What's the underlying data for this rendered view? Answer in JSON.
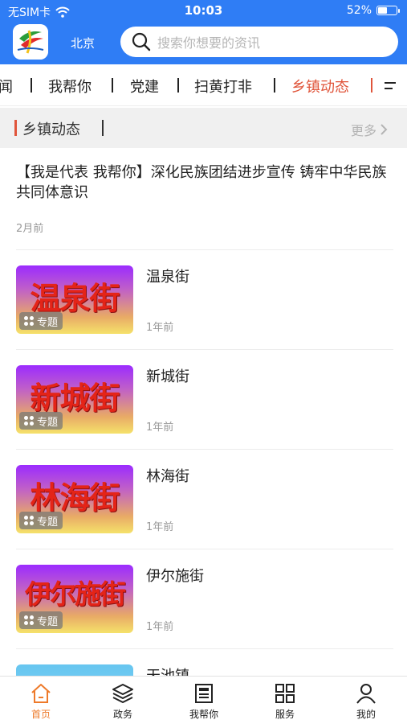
{
  "status_bar": {
    "carrier": "无SIM卡",
    "time": "10:03",
    "battery_text": "52%",
    "battery_level": 0.52
  },
  "header": {
    "city": "北京",
    "search_placeholder": "搜索你想要的资讯"
  },
  "tabs": [
    {
      "label": "闻",
      "active": false
    },
    {
      "label": "我帮你",
      "active": false
    },
    {
      "label": "党建",
      "active": false
    },
    {
      "label": "扫黄打非",
      "active": false
    },
    {
      "label": "乡镇动态",
      "active": true
    }
  ],
  "section": {
    "title": "乡镇动态",
    "more_label": "更多"
  },
  "article": {
    "headline": "【我是代表 我帮你】深化民族团结进步宣传 铸牢中华民族共同体意识",
    "time": "2月前"
  },
  "items": [
    {
      "title": "温泉街",
      "thumb_text": "温泉街",
      "badge": "专题",
      "time": "1年前"
    },
    {
      "title": "新城街",
      "thumb_text": "新城街",
      "badge": "专题",
      "time": "1年前"
    },
    {
      "title": "林海街",
      "thumb_text": "林海街",
      "badge": "专题",
      "time": "1年前"
    },
    {
      "title": "伊尔施街",
      "thumb_text": "伊尔施街",
      "badge": "专题",
      "time": "1年前"
    },
    {
      "title": "天池镇"
    }
  ],
  "bottom_nav": [
    {
      "label": "首页",
      "icon": "home-icon",
      "active": true
    },
    {
      "label": "政务",
      "icon": "layers-icon",
      "active": false
    },
    {
      "label": "我帮你",
      "icon": "newspaper-icon",
      "active": false
    },
    {
      "label": "服务",
      "icon": "grid-icon",
      "active": false
    },
    {
      "label": "我的",
      "icon": "user-icon",
      "active": false
    }
  ],
  "colors": {
    "header_blue": "#2f7df5",
    "accent_red": "#e0553b",
    "nav_active": "#ee7a2a"
  }
}
